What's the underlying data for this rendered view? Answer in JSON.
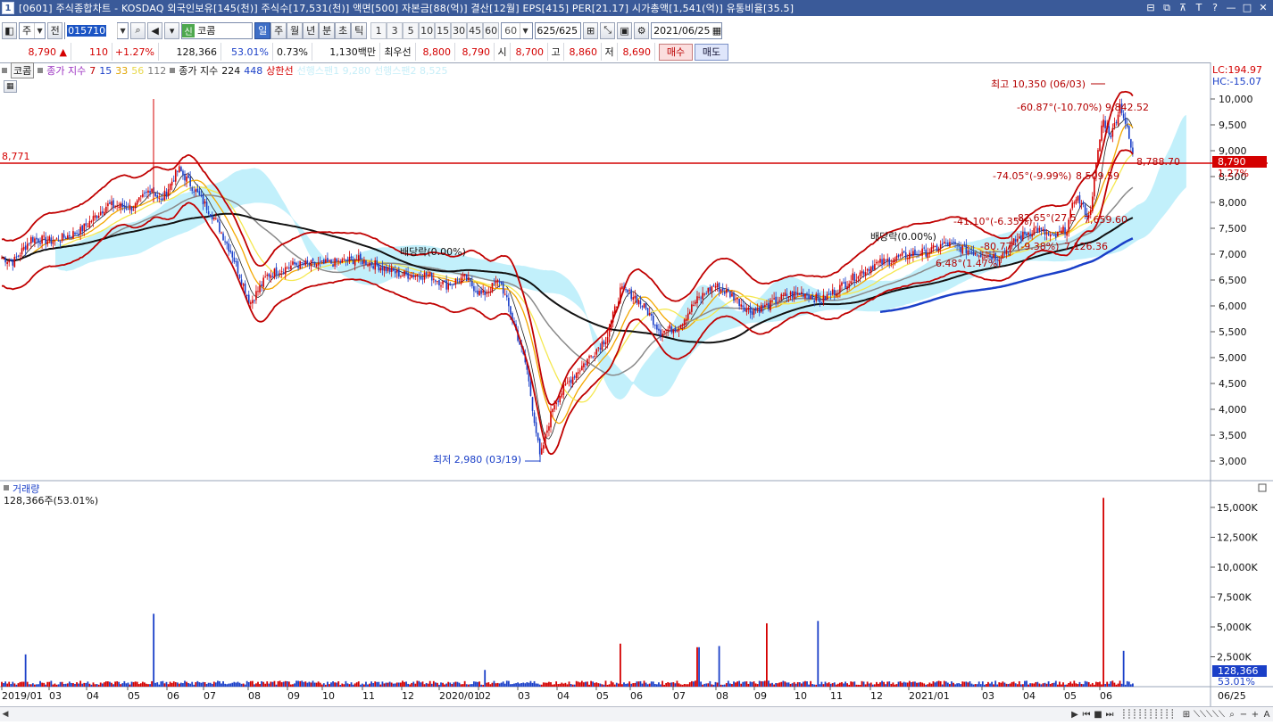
{
  "window": {
    "app_number": "1",
    "title": "[0601] 주식종합차트 - KOSDAQ 외국인보유[145(천)] 주식수[17,531(천)] 액면[500] 자본금[88(억)] 결산[12월] EPS[415] PER[21.17] 시가총액[1,541(억)] 유통비율[35.5]",
    "controls": [
      "minimize-group",
      "restore-group",
      "pin",
      "T",
      "?",
      "—",
      "□",
      "✕"
    ]
  },
  "toolbar": {
    "type_label": "주",
    "prev_label": "전",
    "stock_code": "015710",
    "market_badge": "신",
    "market_name": "코콤",
    "periods": [
      "일",
      "주",
      "월",
      "년",
      "분",
      "초",
      "틱"
    ],
    "active_period": "일",
    "numbers": [
      "1",
      "3",
      "5",
      "10",
      "15",
      "30",
      "45",
      "60"
    ],
    "custom_number": "60",
    "counter": "625/625",
    "date": "2021/06/25"
  },
  "quote": {
    "price": "8,790",
    "change_arrow": "▲",
    "change": "110",
    "change_pct": "+1.27%",
    "volume": "128,366",
    "volume_ratio": "53.01%",
    "turnover": "0.73%",
    "amount": "1,130백만",
    "best_label": "최우선",
    "ask": "8,800",
    "bid": "8,790",
    "open_label": "시",
    "open": "8,700",
    "high_label": "고",
    "high": "8,860",
    "low_label": "저",
    "low": "8,690",
    "buy_label": "매수",
    "sell_label": "매도"
  },
  "legend": {
    "name": "코콤",
    "ma_label": "종가 지수",
    "ma_short": [
      "7",
      "15",
      "33",
      "56",
      "112"
    ],
    "ma_long_label": "종가 지수",
    "ma_long": [
      "224",
      "448"
    ],
    "ceiling": "상한선",
    "extra1": "선행스팬1 9,280",
    "extra2": "선행스팬2 8,525"
  },
  "price_axis": {
    "ticks": [
      "10,000",
      "9,500",
      "9,000",
      "8,500",
      "8,000",
      "7,500",
      "7,000",
      "6,500",
      "6,000",
      "5,500",
      "5,000",
      "4,500",
      "4,000",
      "3,500",
      "3,000"
    ],
    "lc": "LC:194.97",
    "hc": "HC:-15.07",
    "current_badge": "8,790",
    "current_pct": "1.27%"
  },
  "annotations": {
    "hline_value": "8,771",
    "high_note": "최고 10,350 (06/03)",
    "low_note": "최저 2,980 (03/19)",
    "dividend1": "배당락(0.00%)",
    "dividend2": "배당락(0.00%)",
    "angle1": "-60.87°(-10.70%)",
    "val1": "9,842.52",
    "angle2": "-74.05°(-9.99%)",
    "val2": "8,509.59",
    "val3": "8,788.70",
    "angle3": "-41.10°(-6.35%)",
    "angle4": "-82.65°(27.5",
    "val4": "7,659.60",
    "angle5": "-80.77°(-9.38%)",
    "val5": "7,126.36",
    "angle6": "6.48°(1.47%)"
  },
  "volume_panel": {
    "title": "거래량",
    "summary": "128,366주(53.01%)",
    "ticks": [
      "15,000K",
      "12,500K",
      "10,000K",
      "7,500K",
      "5,000K",
      "2,500K"
    ],
    "current_badge": "128,366",
    "current_pct": "53.01%"
  },
  "date_axis": {
    "labels": [
      "2019/01",
      "03",
      "04",
      "05",
      "06",
      "07",
      "08",
      "09",
      "10",
      "11",
      "12",
      "2020/01",
      "02",
      "03",
      "04",
      "05",
      "06",
      "07",
      "08",
      "09",
      "10",
      "11",
      "12",
      "2021/01",
      "03",
      "04",
      "05",
      "06"
    ],
    "end_label": "06/25"
  },
  "colors": {
    "titlebar": "#3a5a99",
    "up": "#d40000",
    "down": "#1a3fc8",
    "cloud": "#b3ecfa",
    "envelope": "#c00000"
  }
}
